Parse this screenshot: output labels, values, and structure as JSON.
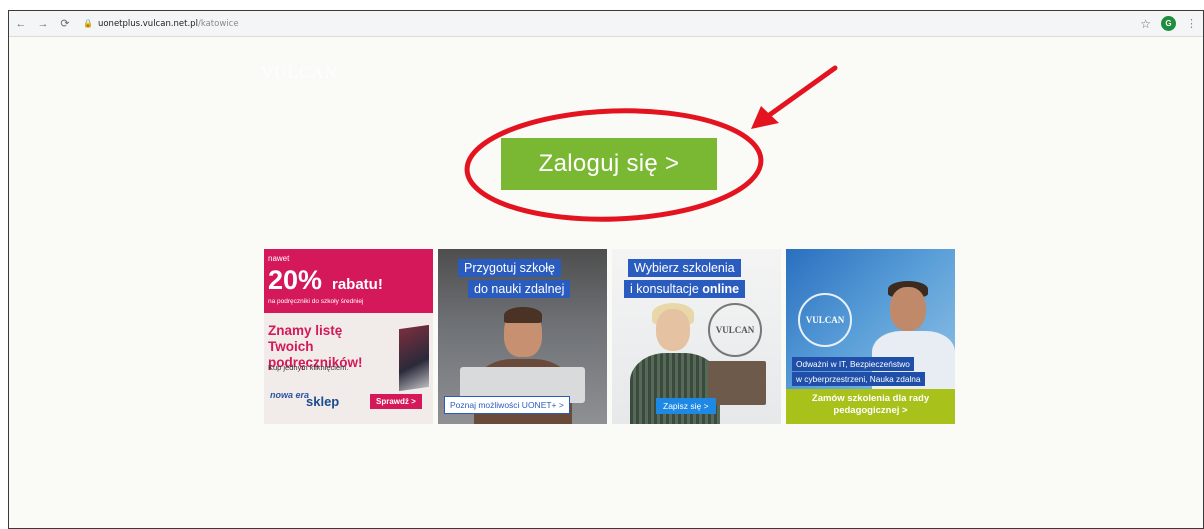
{
  "browser": {
    "url_host": "uonetplus.vulcan.net.pl",
    "url_path": "/katowice",
    "avatar_letter": "G",
    "back_icon": "arrow-left-icon",
    "forward_icon": "arrow-right-icon",
    "reload_icon": "reload-icon"
  },
  "page": {
    "logo_text": "VULCAN",
    "login_button": "Zaloguj się >",
    "accent_color": "#7ab834",
    "annotation_color": "#e3141f"
  },
  "banners": [
    {
      "nawet": "nawet",
      "percent": "20%",
      "rabatu": "rabatu!",
      "sub": "na podręczniki do szkoły średniej",
      "headline": "Znamy listę Twoich podręczników!",
      "kup": "Kup jednym kliknięciem.",
      "brand1": "nowa era",
      "brand2": "sklep",
      "cta": "Sprawdź >"
    },
    {
      "line1": "Przygotuj szkołę",
      "line2": "do nauki zdalnej",
      "cta": "Poznaj możliwości UONET+ >"
    },
    {
      "line1": "Wybierz szkolenia",
      "line2a": "i konsultacje ",
      "line2b": "online",
      "stamp": "VULCAN",
      "cta": "Zapisz się >"
    },
    {
      "stamp": "VULCAN",
      "line1": "Odważni w IT, Bezpieczeństwo",
      "line2": "w cyberprzestrzeni, Nauka zdalna",
      "cta": "Zamów szkolenia dla rady pedagogicznej >"
    }
  ]
}
